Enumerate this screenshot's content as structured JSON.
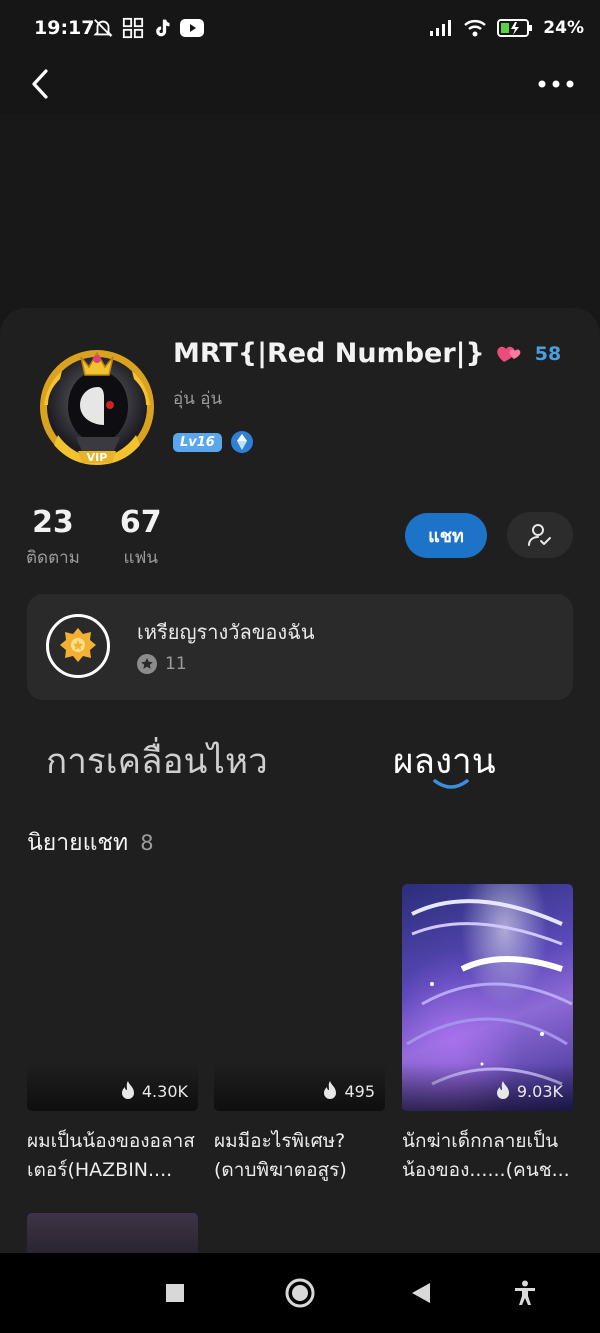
{
  "status_bar": {
    "time": "19:17",
    "battery": "24"
  },
  "profile": {
    "name": "MRT{|Red Number|}",
    "heart_count": "58",
    "subname": "อุ่น อุ่น",
    "level": "Lv16",
    "vip_label": "VIP"
  },
  "stats": {
    "following_count": "23",
    "following_label": "ติดตาม",
    "fans_count": "67",
    "fans_label": "แฟน"
  },
  "actions": {
    "chat_label": "แชท"
  },
  "medals": {
    "title": "เหรียญรางวัลของฉัน",
    "count": "11"
  },
  "tabs": [
    {
      "label": "การเคลื่อนไหว",
      "active": false
    },
    {
      "label": "ผลงาน",
      "active": true
    }
  ],
  "section": {
    "title": "นิยายแชท",
    "count": "8"
  },
  "novels": [
    {
      "title": "ผมเป็นน้องของอลาสเตอร์(HAZBIN....",
      "views": "4.30K"
    },
    {
      "title": "ผมมีอะไรพิเศษ?(ดาบพิฆาตอสูร)",
      "views": "495"
    },
    {
      "title": "นักฆ่าเด็กกลายเป็นน้องของ......(คนช...",
      "views": "9.03K"
    }
  ],
  "colors": {
    "accent": "#1d73c7",
    "link_blue": "#4a9fe0",
    "background": "#161616",
    "card": "#1f1f1f"
  }
}
